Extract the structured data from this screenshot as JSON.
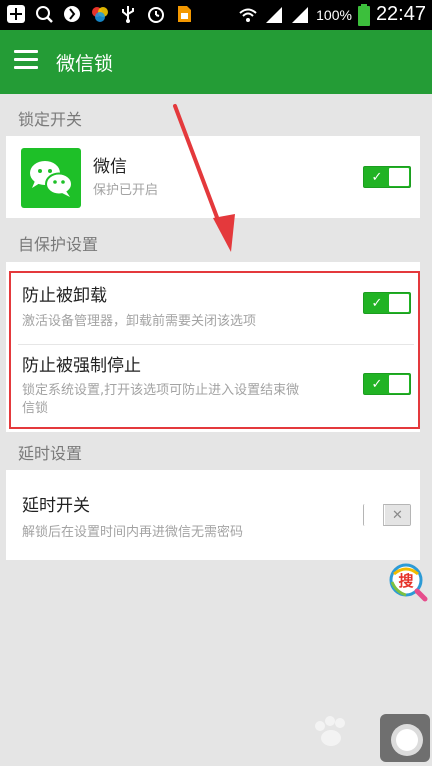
{
  "status_bar": {
    "battery_percent": "100%",
    "time": "22:47",
    "icons": [
      "add-icon",
      "search-icon",
      "shield-icon",
      "color-app-icon",
      "usb-icon",
      "alarm-icon",
      "sim-icon",
      "wifi-icon",
      "signal-icon",
      "battery-icon"
    ]
  },
  "app_bar": {
    "title": "微信锁",
    "menu_icon": "menu-icon",
    "color": "#249c36"
  },
  "sections": {
    "lock_switch": {
      "title": "锁定开关",
      "app": {
        "name": "微信",
        "status": "保护已开启",
        "icon": "wechat-icon",
        "toggle_on": true
      }
    },
    "self_protect": {
      "title": "自保护设置",
      "items": [
        {
          "title": "防止被卸载",
          "desc": "激活设备管理器，卸载前需要关闭该选项",
          "toggle_on": true
        },
        {
          "title": "防止被强制停止",
          "desc_line1": "锁定系统设置,打开该选项可防止进入设置结束微",
          "desc_line2": "信锁",
          "toggle_on": true
        }
      ]
    },
    "delay": {
      "title": "延时设置",
      "item": {
        "title": "延时开关",
        "desc": "解锁后在设置时间内再进微信无需密码",
        "toggle_on": false
      }
    }
  },
  "toggle_marks": {
    "on": "✓",
    "off": "✕"
  },
  "floating_search": {
    "label": "搜",
    "icon": "search-fab-icon"
  },
  "colors": {
    "toggle_on": "#21b324",
    "highlight_box": "#e4393c",
    "arrow": "#e4393c",
    "background": "#e5e5e5"
  }
}
